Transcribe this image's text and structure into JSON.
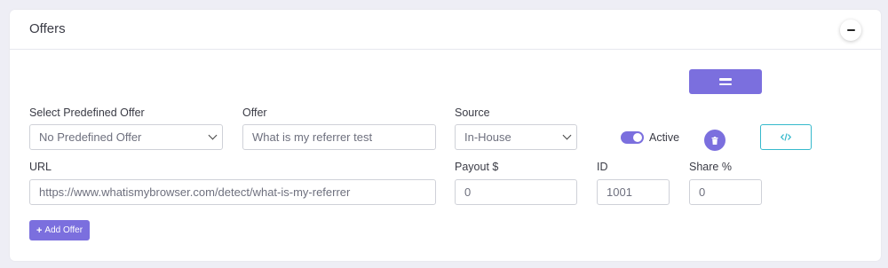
{
  "card": {
    "title": "Offers",
    "collapse_icon": "minus-icon"
  },
  "form": {
    "predefined": {
      "label": "Select Predefined Offer",
      "value": "No Predefined Offer"
    },
    "offer": {
      "label": "Offer",
      "value": "What is my referrer test"
    },
    "source": {
      "label": "Source",
      "value": "In-House"
    },
    "active": {
      "label": "Active",
      "on": true
    },
    "url": {
      "label": "URL",
      "value": "https://www.whatismybrowser.com/detect/what-is-my-referrer"
    },
    "payout": {
      "label": "Payout $",
      "value": "0"
    },
    "id": {
      "label": "ID",
      "value": "1001"
    },
    "share": {
      "label": "Share %",
      "value": "0"
    }
  },
  "buttons": {
    "drag_icon": "drag-handle-icon",
    "delete_icon": "trash-icon",
    "code_icon": "code-icon",
    "add_offer": "Add Offer",
    "add_icon": "plus-icon"
  },
  "colors": {
    "accent": "#7b6fde",
    "info": "#36b9cc",
    "background": "#eeeef5"
  }
}
